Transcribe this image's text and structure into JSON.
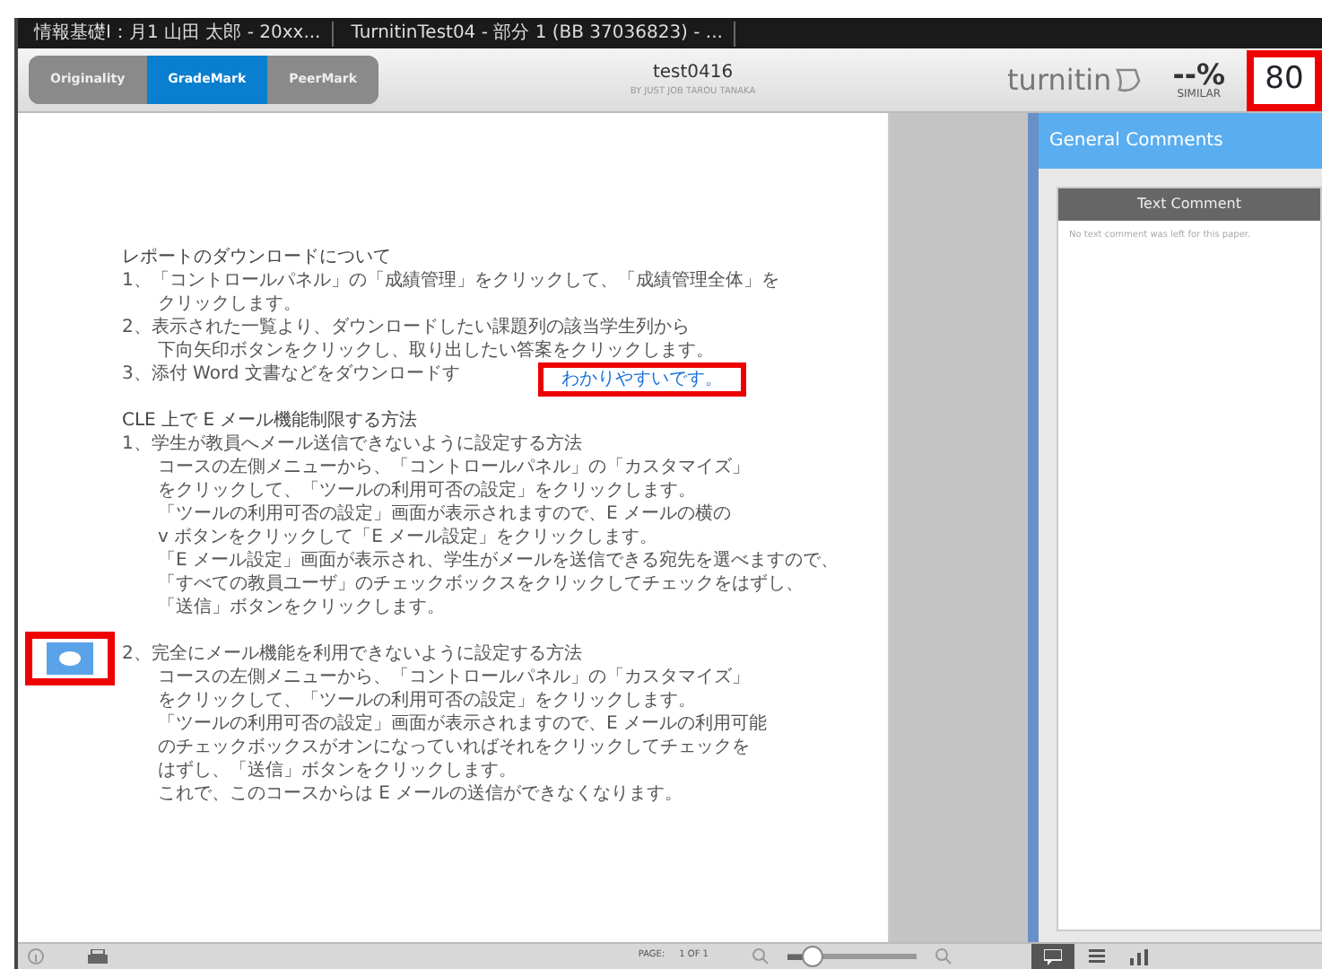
{
  "browser_tabs": [
    {
      "label": "情報基礎Ⅰ：月1 山田 太郎 - 20xx..."
    },
    {
      "label": "TurnitinTest04 - 部分 1 (BB 37036823) - ..."
    }
  ],
  "modes": [
    {
      "label": "Originality",
      "selected": false
    },
    {
      "label": "GradeMark",
      "selected": true
    },
    {
      "label": "PeerMark",
      "selected": false
    }
  ],
  "paper": {
    "title": "test0416",
    "byline": "BY JUST   JOB TAROU TANAKA"
  },
  "logo": "turnitin",
  "similarity": {
    "value": "--%",
    "label": "SIMILAR"
  },
  "score": "80",
  "document": {
    "lines": [
      {
        "kind": "heading",
        "text": "レポートのダウンロードについて"
      },
      {
        "kind": "item",
        "text": "1、「コントロールパネル」の「成績管理」をクリックして、「成績管理全体」を"
      },
      {
        "kind": "cont",
        "text": "クリックします。"
      },
      {
        "kind": "item",
        "text": "2、表示された一覧より、ダウンロードしたい課題列の該当学生列から"
      },
      {
        "kind": "cont",
        "text": "下向矢印ボタンをクリックし、取り出したい答案をクリックします。"
      },
      {
        "kind": "item",
        "text": "3、添付 Word 文書などをダウンロードす"
      },
      {
        "kind": "gap"
      },
      {
        "kind": "heading",
        "text": "CLE 上で E メール機能制限する方法"
      },
      {
        "kind": "item",
        "text": "1、学生が教員へメール送信できないように設定する方法"
      },
      {
        "kind": "cont",
        "text": "コースの左側メニューから、「コントロールパネル」の「カスタマイズ」"
      },
      {
        "kind": "cont",
        "text": "をクリックして、「ツールの利用可否の設定」をクリックします。"
      },
      {
        "kind": "cont",
        "text": "「ツールの利用可否の設定」画面が表示されますので、E メールの横の"
      },
      {
        "kind": "cont",
        "text": "v ボタンをクリックして「E メール設定」をクリックします。"
      },
      {
        "kind": "cont",
        "text": "「E メール設定」画面が表示され、学生がメールを送信できる宛先を選べますので、"
      },
      {
        "kind": "cont",
        "text": "「すべての教員ユーザ」のチェックボックスをクリックしてチェックをはずし、"
      },
      {
        "kind": "cont",
        "text": "「送信」ボタンをクリックします。"
      },
      {
        "kind": "gap"
      },
      {
        "kind": "item",
        "text": "2、完全にメール機能を利用できないように設定する方法"
      },
      {
        "kind": "cont",
        "text": "コースの左側メニューから、「コントロールパネル」の「カスタマイズ」"
      },
      {
        "kind": "cont",
        "text": "をクリックして、「ツールの利用可否の設定」をクリックします。"
      },
      {
        "kind": "cont",
        "text": "「ツールの利用可否の設定」画面が表示されますので、E メールの利用可能"
      },
      {
        "kind": "cont",
        "text": "のチェックボックスがオンになっていればそれをクリックしてチェックを"
      },
      {
        "kind": "cont",
        "text": "はずし、「送信」ボタンをクリックします。"
      },
      {
        "kind": "cont",
        "text": "これで、このコースからは E メールの送信ができなくなります。"
      }
    ],
    "bubble": "わかりやすいです。"
  },
  "panel": {
    "title": "General Comments",
    "section": "Text Comment",
    "message": "No text comment was left for this paper."
  },
  "footer": {
    "page_label": "PAGE:",
    "page": "1 OF 1",
    "zoom": {
      "level": 0.2
    }
  }
}
